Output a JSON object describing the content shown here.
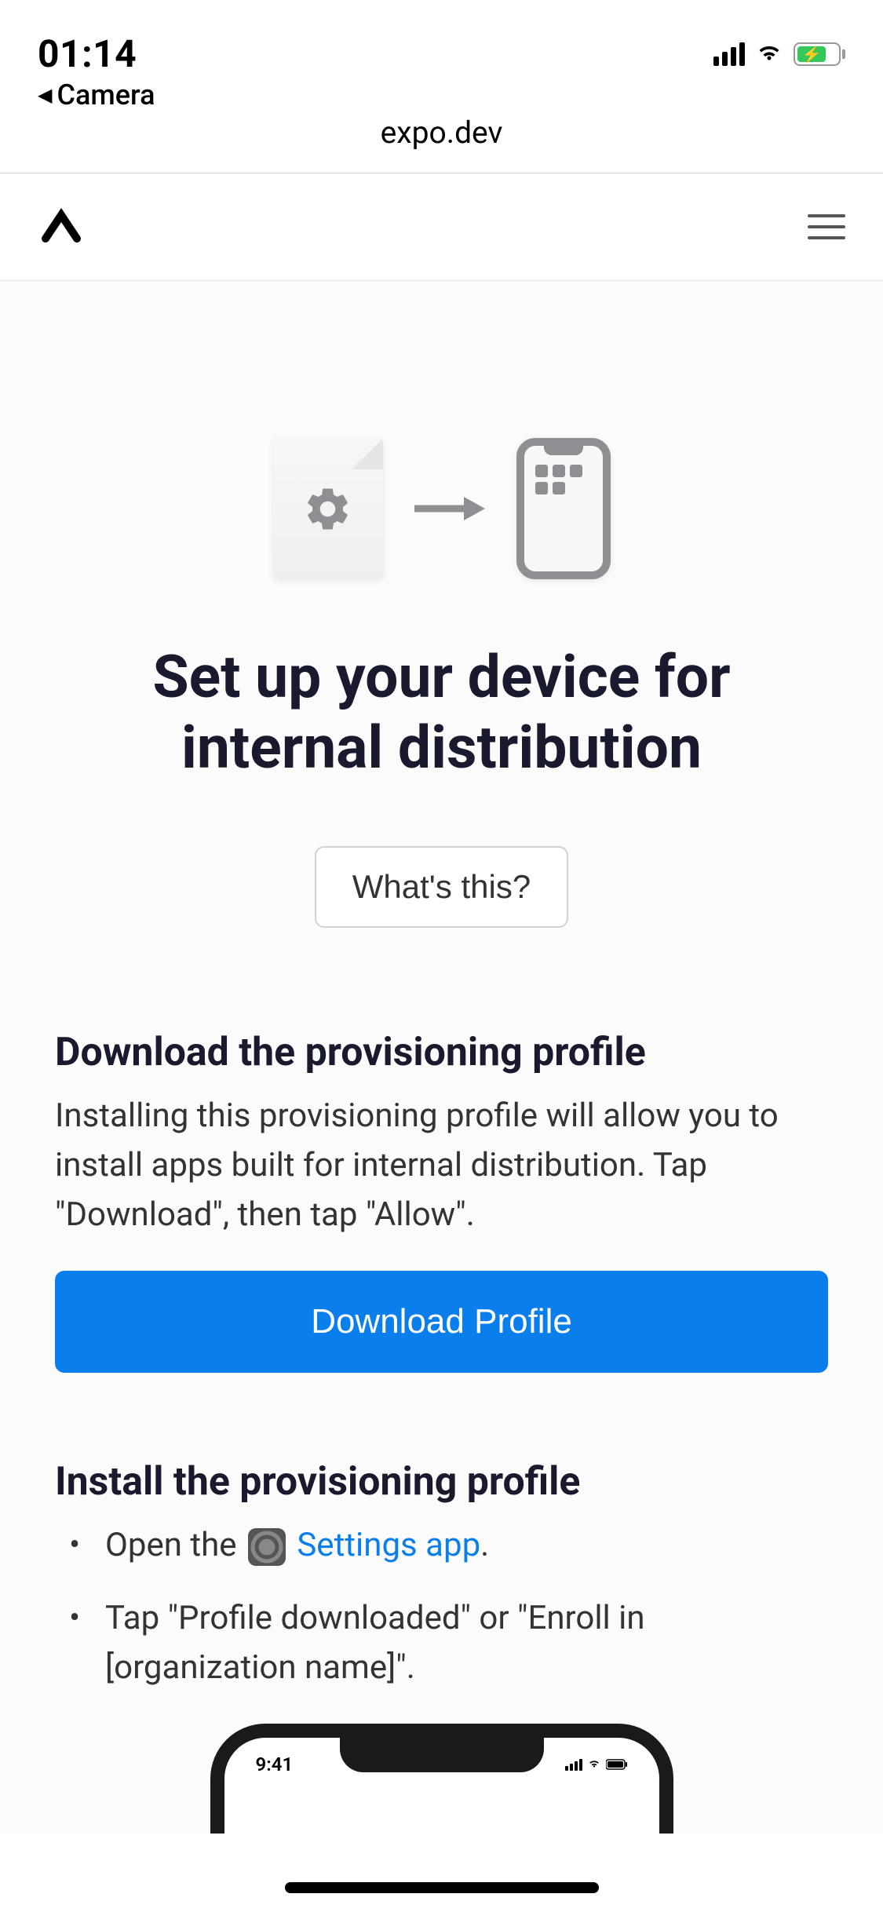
{
  "statusBar": {
    "time": "01:14",
    "backApp": "Camera"
  },
  "browser": {
    "url": "expo.dev"
  },
  "page": {
    "title": "Set up your device for internal distribution",
    "whatsThis": "What's this?",
    "section1": {
      "title": "Download the provisioning profile",
      "text": "Installing this provisioning profile will allow you to install apps built for internal distribution. Tap \"Download\", then tap \"Allow\".",
      "button": "Download Profile"
    },
    "section2": {
      "title": "Install the provisioning profile",
      "step1_prefix": "Open the ",
      "step1_link": "Settings app",
      "step1_suffix": ".",
      "step2": "Tap \"Profile downloaded\" or \"Enroll in [organization name]\"."
    }
  },
  "mockup": {
    "time": "9:41"
  }
}
